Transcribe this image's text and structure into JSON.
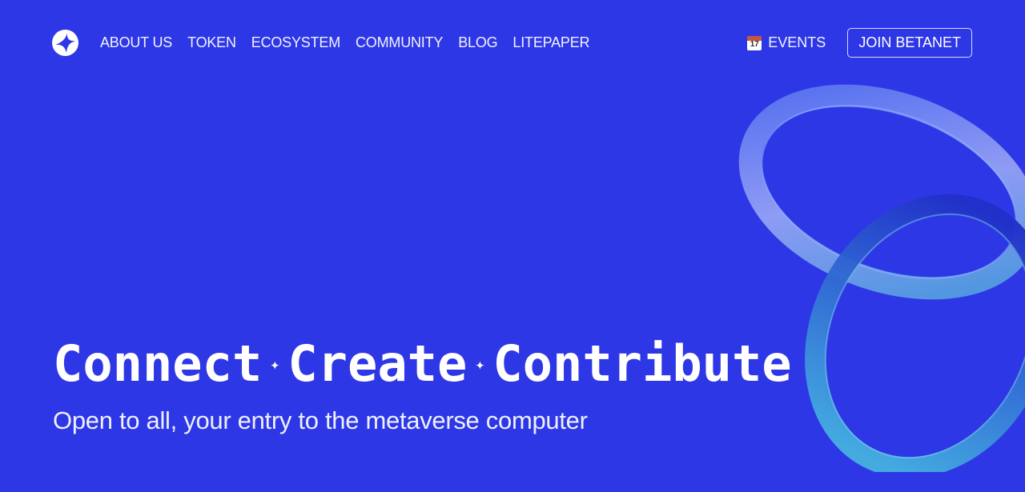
{
  "nav": {
    "links": [
      "ABOUT US",
      "TOKEN",
      "ECOSYSTEM",
      "COMMUNITY",
      "BLOG",
      "LITEPAPER"
    ],
    "events": {
      "label": "EVENTS",
      "icon": "calendar-icon",
      "day": "17"
    },
    "join_label": "JOIN BETANET"
  },
  "hero": {
    "words": [
      "Connect",
      "Create",
      "Contribute"
    ],
    "separator": "✦",
    "subtitle": "Open to all, your entry to the metaverse computer"
  },
  "colors": {
    "background": "#2d37e6"
  }
}
